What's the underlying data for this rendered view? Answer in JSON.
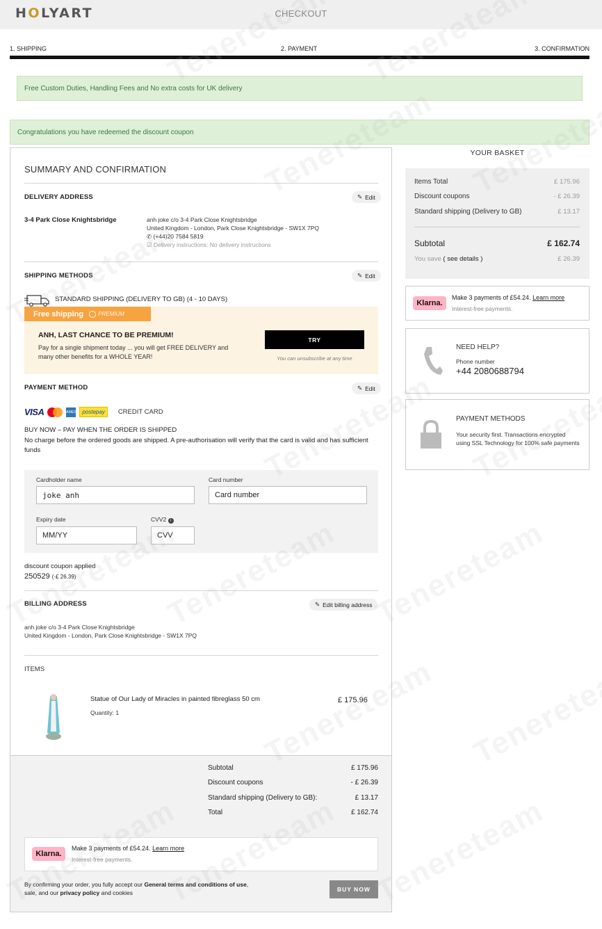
{
  "header": {
    "logo_prefix": "H",
    "logo_o": "O",
    "logo_suffix": "LYART",
    "title": "CHECKOUT"
  },
  "steps": [
    "1. SHIPPING",
    "2. PAYMENT",
    "3. CONFIRMATION"
  ],
  "alerts": {
    "uk_delivery": "Free Custom Duties, Handling Fees and No extra costs for UK delivery",
    "coupon": "Congratulations you have redeemed the discount coupon"
  },
  "summary": {
    "title": "SUMMARY AND CONFIRMATION",
    "edit_label": "Edit",
    "delivery": {
      "heading": "DELIVERY ADDRESS",
      "name": "3-4 Park Close Knightsbridge",
      "line1": "anh joke c/o 3-4 Park Close Knightsbridge",
      "line2": "United Kingdom - London, Park Close Knightsbridge - SW1X 7PQ",
      "phone": "(+44)20 7584 5819",
      "instructions": "Delivery instructions: No delivery instructions"
    },
    "shipping": {
      "heading": "SHIPPING METHODS",
      "method": "STANDARD SHIPPING (DELIVERY TO GB) (4 - 10 DAYS)"
    },
    "premium": {
      "tag": "Free shipping",
      "badge": "PREMIUM",
      "headline": "ANH, LAST CHANCE TO BE PREMIUM!",
      "body": "Pay for a single shipment today ... you will get FREE DELIVERY and many other benefits for a WHOLE YEAR!",
      "try_label": "TRY",
      "unsubscribe": "You can unsubscribe at any time"
    },
    "payment": {
      "heading": "PAYMENT METHOD",
      "visa": "VISA",
      "amex": "AMEX",
      "postepay": "postepay",
      "method_label": "CREDIT CARD",
      "buy_now_title": "BUY NOW – PAY WHEN THE ORDER IS SHIPPED",
      "buy_now_desc": "No charge before the ordered goods are shipped. A pre-authorisation will verify that the card is valid and has sufficient funds"
    },
    "form": {
      "cardholder_label": "Cardholder name",
      "cardholder_value": "joke anh",
      "card_number_label": "Card number",
      "card_number_placeholder": "Card number",
      "expiry_label": "Expiry date",
      "expiry_placeholder": "MM/YY",
      "cvv_label": "CVV2",
      "cvv_placeholder": "CVV"
    },
    "coupon": {
      "label": "discount coupon applied",
      "code": "250529",
      "amount": "(-£ 26.39)"
    },
    "billing": {
      "heading": "BILLING ADDRESS",
      "edit_label": "Edit billing address",
      "line1": "anh joke c/o 3-4 Park Close Knightsbridge",
      "line2": "United Kingdom - London, Park Close Knightsbridge - SW1X 7PQ"
    },
    "items": {
      "heading": "ITEMS",
      "list": [
        {
          "name": "Statue of Our Lady of Miracles in painted fibreglass 50 cm",
          "quantity": "Quantity: 1",
          "price": "£ 175.96"
        }
      ]
    },
    "totals": {
      "subtotal_label": "Subtotal",
      "subtotal": "£ 175.96",
      "discount_label": "Discount coupons",
      "discount": "- £ 26.39",
      "shipping_label": "Standard shipping (Delivery to GB):",
      "shipping": "£ 13.17",
      "total_label": "Total",
      "total": "£ 162.74"
    },
    "klarna": {
      "logo": "Klarna.",
      "text": "Make 3 payments of £54.24.",
      "link": "Learn more",
      "sub": "Interest-free payments."
    },
    "terms": {
      "prefix": "By confirming your order, you fully accept our",
      "terms_link": "General terms and conditions of use",
      "mid": ", sale, and our",
      "privacy_link": "privacy policy",
      "suffix": "and cookies"
    },
    "buy_now_button": "BUY NOW"
  },
  "basket": {
    "title": "YOUR BASKET",
    "items_total_label": "Items Total",
    "items_total": "£ 175.96",
    "discount_label": "Discount coupons",
    "discount": "- £ 26.39",
    "shipping_label": "Standard shipping (Delivery to GB)",
    "shipping": "£ 13.17",
    "subtotal_label": "Subtotal",
    "subtotal": "£ 162.74",
    "save_label": "You save",
    "save_link": "( see details )",
    "save": "£ 26.39"
  },
  "side_klarna": {
    "logo": "Klarna.",
    "text": "Make 3 payments of £54.24.",
    "link": "Learn more",
    "sub": "Interest-free payments."
  },
  "help": {
    "title": "NEED HELP?",
    "phone_label": "Phone number",
    "phone": "+44 2080688794"
  },
  "security": {
    "title": "PAYMENT METHODS",
    "text": "Your security first. Transactions encrypted using SSL Technology for 100% safe payments"
  },
  "watermark": "Tenereteam",
  "colors": {
    "premium_orange": "#f7a440",
    "alert_green_bg": "#dff0d8",
    "alert_green_text": "#3c763d",
    "klarna_pink": "#ffb3c7"
  }
}
